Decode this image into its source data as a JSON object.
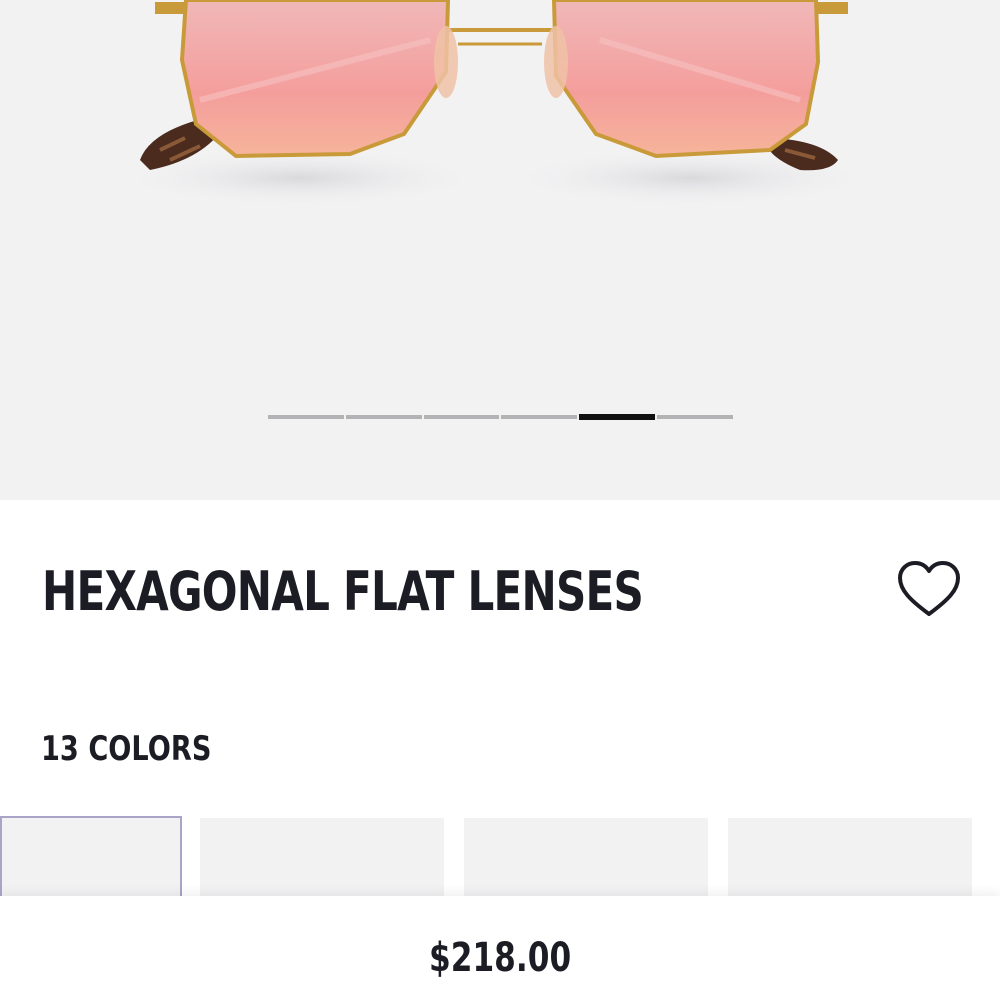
{
  "product": {
    "title": "HEXAGONAL FLAT LENSES",
    "colors_count_label": "13 COLORS",
    "price": "$218.00",
    "lens_color": "#f2a6a8",
    "frame_color": "#c99a3a"
  },
  "carousel": {
    "slides": 6,
    "active_index": 4
  },
  "icons": {
    "favorite": "heart-outline-icon"
  },
  "colors": {
    "hero_background": "#f2f2f3",
    "text": "#1c1c24",
    "selected_border": "#a9a4c8"
  }
}
